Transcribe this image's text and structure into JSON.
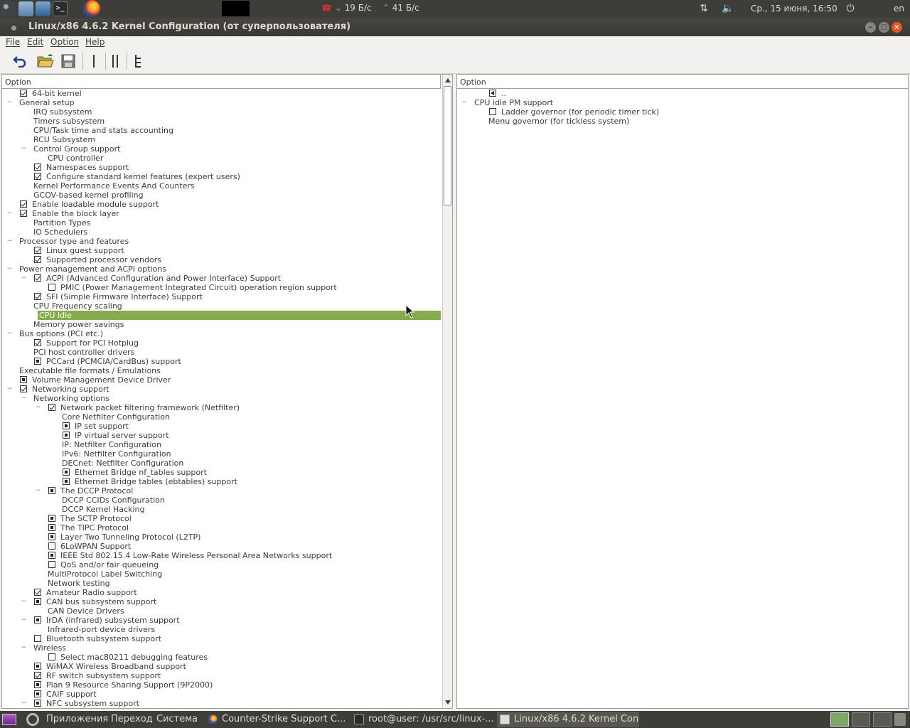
{
  "top_panel": {
    "launchers": [
      "steam-icon",
      "home-folder-icon",
      "virtualbox-icon",
      "terminal-icon",
      "firefox-icon"
    ],
    "net_down": "19 Б/с",
    "net_up": "41 Б/с",
    "datetime": "Ср., 15 июня, 16:50",
    "lang": "en"
  },
  "window": {
    "title": "Linux/x86 4.6.2 Kernel Configuration (от суперпользователя)"
  },
  "menubar": [
    "File",
    "Edit",
    "Option",
    "Help"
  ],
  "toolbar": [
    "undo-icon",
    "open-folder-icon",
    "save-icon",
    "single-view-icon",
    "split-view-icon",
    "full-tree-icon"
  ],
  "left_pane": {
    "header": "Option",
    "rows": [
      {
        "d": 0,
        "tog": "",
        "cb": "on",
        "label": "64-bit kernel"
      },
      {
        "d": 0,
        "tog": "-",
        "cb": "",
        "label": "General setup"
      },
      {
        "d": 1,
        "tog": "",
        "cb": "",
        "label": "IRQ subsystem"
      },
      {
        "d": 1,
        "tog": "",
        "cb": "",
        "label": "Timers subsystem"
      },
      {
        "d": 1,
        "tog": "",
        "cb": "",
        "label": "CPU/Task time and stats accounting"
      },
      {
        "d": 1,
        "tog": "",
        "cb": "",
        "label": "RCU Subsystem"
      },
      {
        "d": 1,
        "tog": "-",
        "cb": "",
        "label": "Control Group support"
      },
      {
        "d": 2,
        "tog": "",
        "cb": "",
        "label": "CPU controller"
      },
      {
        "d": 1,
        "tog": "",
        "cb": "on",
        "label": "Namespaces support"
      },
      {
        "d": 1,
        "tog": "",
        "cb": "on",
        "label": "Configure standard kernel features (expert users)"
      },
      {
        "d": 1,
        "tog": "",
        "cb": "",
        "label": "Kernel Performance Events And Counters"
      },
      {
        "d": 1,
        "tog": "",
        "cb": "",
        "label": "GCOV-based kernel profiling"
      },
      {
        "d": 0,
        "tog": "",
        "cb": "on",
        "label": "Enable loadable module support"
      },
      {
        "d": 0,
        "tog": "-",
        "cb": "on",
        "label": "Enable the block layer"
      },
      {
        "d": 1,
        "tog": "",
        "cb": "",
        "label": "Partition Types"
      },
      {
        "d": 1,
        "tog": "",
        "cb": "",
        "label": "IO Schedulers"
      },
      {
        "d": 0,
        "tog": "-",
        "cb": "",
        "label": "Processor type and features"
      },
      {
        "d": 1,
        "tog": "",
        "cb": "on",
        "label": "Linux guest support"
      },
      {
        "d": 1,
        "tog": "",
        "cb": "on",
        "label": "Supported processor vendors"
      },
      {
        "d": 0,
        "tog": "-",
        "cb": "",
        "label": "Power management and ACPI options"
      },
      {
        "d": 1,
        "tog": "-",
        "cb": "on",
        "label": "ACPI (Advanced Configuration and Power Interface) Support"
      },
      {
        "d": 2,
        "tog": "",
        "cb": "off",
        "label": "PMIC (Power Management Integrated Circuit) operation region support"
      },
      {
        "d": 1,
        "tog": "",
        "cb": "on",
        "label": "SFI (Simple Firmware Interface) Support"
      },
      {
        "d": 1,
        "tog": "",
        "cb": "",
        "label": "CPU Frequency scaling"
      },
      {
        "d": 1,
        "tog": "",
        "cb": "",
        "label": "CPU Idle",
        "sel": true
      },
      {
        "d": 1,
        "tog": "",
        "cb": "",
        "label": "Memory power savings"
      },
      {
        "d": 0,
        "tog": "-",
        "cb": "",
        "label": "Bus options (PCI etc.)"
      },
      {
        "d": 1,
        "tog": "",
        "cb": "on",
        "label": "Support for PCI Hotplug"
      },
      {
        "d": 1,
        "tog": "",
        "cb": "",
        "label": "PCI host controller drivers"
      },
      {
        "d": 1,
        "tog": "",
        "cb": "mod",
        "label": "PCCard (PCMCIA/CardBus) support"
      },
      {
        "d": 0,
        "tog": "",
        "cb": "",
        "label": "Executable file formats / Emulations"
      },
      {
        "d": 0,
        "tog": "",
        "cb": "mod",
        "label": "Volume Management Device Driver"
      },
      {
        "d": 0,
        "tog": "-",
        "cb": "on",
        "label": "Networking support"
      },
      {
        "d": 1,
        "tog": "-",
        "cb": "",
        "label": "Networking options"
      },
      {
        "d": 2,
        "tog": "-",
        "cb": "on",
        "label": "Network packet filtering framework (Netfilter)"
      },
      {
        "d": 3,
        "tog": "",
        "cb": "",
        "label": "Core Netfilter Configuration"
      },
      {
        "d": 3,
        "tog": "",
        "cb": "mod",
        "label": "IP set support"
      },
      {
        "d": 3,
        "tog": "",
        "cb": "mod",
        "label": "IP virtual server support"
      },
      {
        "d": 3,
        "tog": "",
        "cb": "",
        "label": "IP: Netfilter Configuration"
      },
      {
        "d": 3,
        "tog": "",
        "cb": "",
        "label": "IPv6: Netfilter Configuration"
      },
      {
        "d": 3,
        "tog": "",
        "cb": "",
        "label": "DECnet: Netfilter Configuration"
      },
      {
        "d": 3,
        "tog": "",
        "cb": "mod",
        "label": "Ethernet Bridge nf_tables support"
      },
      {
        "d": 3,
        "tog": "",
        "cb": "mod",
        "label": "Ethernet Bridge tables (ebtables) support"
      },
      {
        "d": 2,
        "tog": "-",
        "cb": "mod",
        "label": "The DCCP Protocol"
      },
      {
        "d": 3,
        "tog": "",
        "cb": "",
        "label": "DCCP CCIDs Configuration"
      },
      {
        "d": 3,
        "tog": "",
        "cb": "",
        "label": "DCCP Kernel Hacking"
      },
      {
        "d": 2,
        "tog": "",
        "cb": "mod",
        "label": "The SCTP Protocol"
      },
      {
        "d": 2,
        "tog": "",
        "cb": "mod",
        "label": "The TIPC Protocol"
      },
      {
        "d": 2,
        "tog": "",
        "cb": "mod",
        "label": "Layer Two Tunneling Protocol (L2TP)"
      },
      {
        "d": 2,
        "tog": "",
        "cb": "off",
        "label": "6LoWPAN Support"
      },
      {
        "d": 2,
        "tog": "",
        "cb": "mod",
        "label": "IEEE Std 802.15.4 Low-Rate Wireless Personal Area Networks support"
      },
      {
        "d": 2,
        "tog": "",
        "cb": "off",
        "label": "QoS and/or fair queueing"
      },
      {
        "d": 2,
        "tog": "",
        "cb": "",
        "label": "MultiProtocol Label Switching"
      },
      {
        "d": 2,
        "tog": "",
        "cb": "",
        "label": "Network testing"
      },
      {
        "d": 1,
        "tog": "",
        "cb": "on",
        "label": "Amateur Radio support"
      },
      {
        "d": 1,
        "tog": "-",
        "cb": "mod",
        "label": "CAN bus subsystem support"
      },
      {
        "d": 2,
        "tog": "",
        "cb": "",
        "label": "CAN Device Drivers"
      },
      {
        "d": 1,
        "tog": "-",
        "cb": "mod",
        "label": "IrDA (infrared) subsystem support"
      },
      {
        "d": 2,
        "tog": "",
        "cb": "",
        "label": "Infrared-port device drivers"
      },
      {
        "d": 1,
        "tog": "",
        "cb": "off",
        "label": "Bluetooth subsystem support"
      },
      {
        "d": 1,
        "tog": "-",
        "cb": "",
        "label": "Wireless"
      },
      {
        "d": 2,
        "tog": "",
        "cb": "off",
        "label": "Select mac80211 debugging features"
      },
      {
        "d": 1,
        "tog": "",
        "cb": "mod",
        "label": "WiMAX Wireless Broadband support"
      },
      {
        "d": 1,
        "tog": "",
        "cb": "on",
        "label": "RF switch subsystem support"
      },
      {
        "d": 1,
        "tog": "",
        "cb": "mod",
        "label": "Plan 9 Resource Sharing Support (9P2000)"
      },
      {
        "d": 1,
        "tog": "",
        "cb": "mod",
        "label": "CAIF support"
      },
      {
        "d": 1,
        "tog": "-",
        "cb": "mod",
        "label": "NFC subsystem support"
      }
    ]
  },
  "right_pane": {
    "header": "Option",
    "rows": [
      {
        "d": 1,
        "tog": "",
        "cb": "menu",
        "label": ".."
      },
      {
        "d": 0,
        "tog": "-",
        "cb": "",
        "label": "CPU idle PM support"
      },
      {
        "d": 1,
        "tog": "",
        "cb": "off",
        "label": "Ladder governor (for periodic timer tick)"
      },
      {
        "d": 1,
        "tog": "",
        "cb": "",
        "label": "Menu governor (for tickless system)"
      }
    ]
  },
  "taskbar": {
    "apps": "Приложения",
    "places": "Переход",
    "system": "Система",
    "tasks": [
      {
        "label": "Counter-Strike Support C...",
        "icon": "firefox-icon"
      },
      {
        "label": "root@user: /usr/src/linux-...",
        "icon": "terminal-icon"
      },
      {
        "label": "Linux/x86 4.6.2 Kernel Con...",
        "icon": "window-icon",
        "active": true
      }
    ]
  },
  "colors": {
    "selection": "#84ab4d",
    "panel": "#3d3d39",
    "close": "#e8572a"
  }
}
